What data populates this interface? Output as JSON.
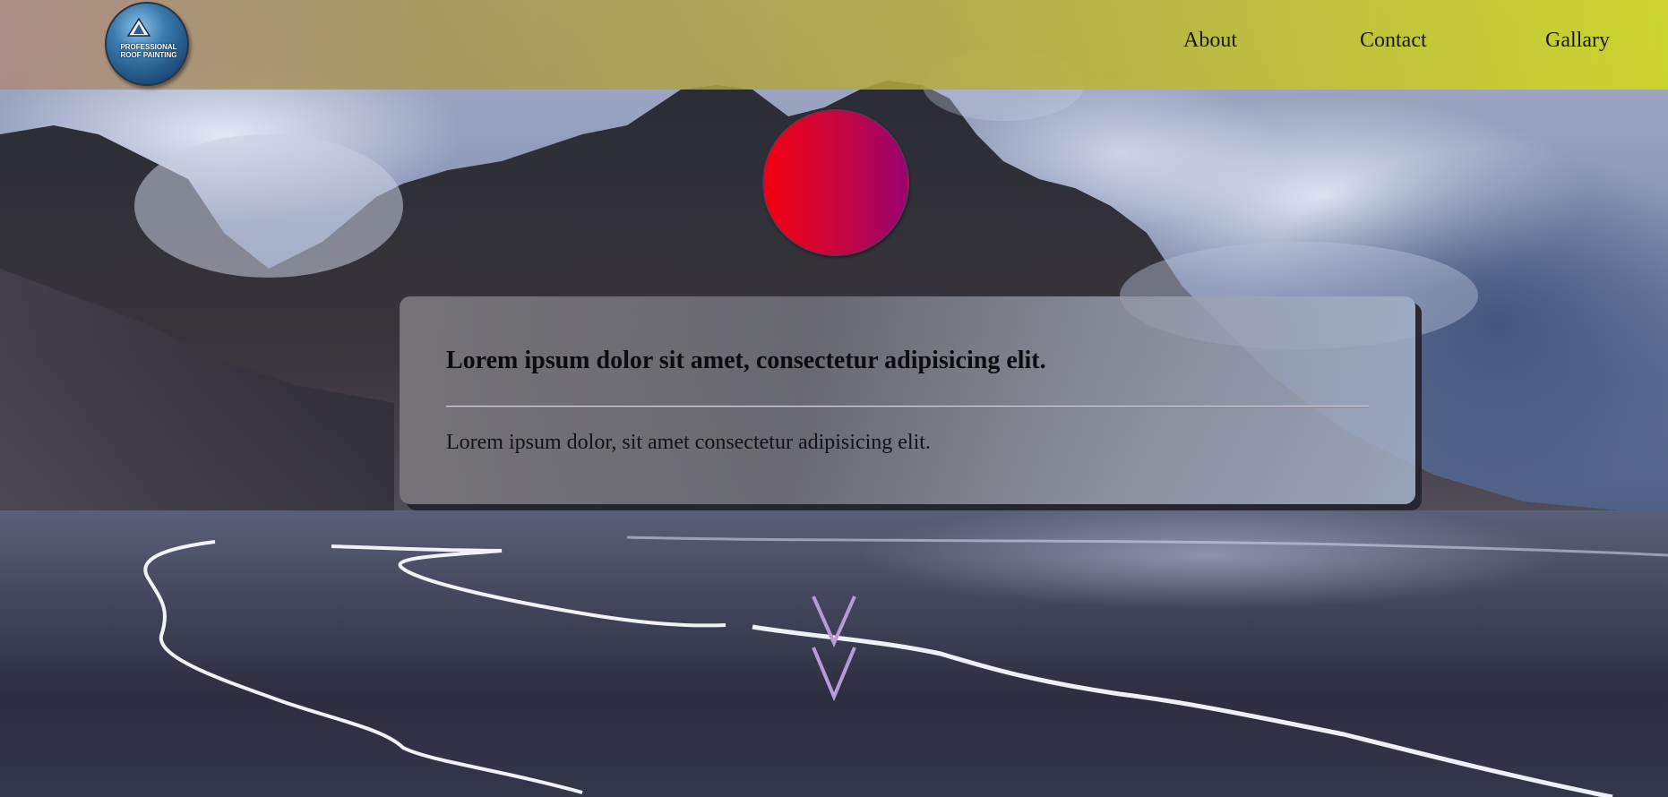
{
  "header": {
    "logo": {
      "line1": "PROFESSIONAL",
      "line2": "ROOF PAINTING"
    },
    "nav": [
      {
        "label": "About"
      },
      {
        "label": "Contact"
      },
      {
        "label": "Gallary"
      }
    ]
  },
  "hero": {
    "card": {
      "title": "Lorem ipsum dolor sit amet, consectetur adipisicing elit.",
      "body": "Lorem ipsum dolor, sit amet consectetur adipisicing elit."
    },
    "scroll_icon": "double-chevron-down-icon"
  },
  "colors": {
    "header_start": "#ac8c82",
    "header_end": "#cdd626",
    "circle_start": "#f5000e",
    "circle_end": "#9b0370",
    "chevron": "#b89ad8"
  }
}
